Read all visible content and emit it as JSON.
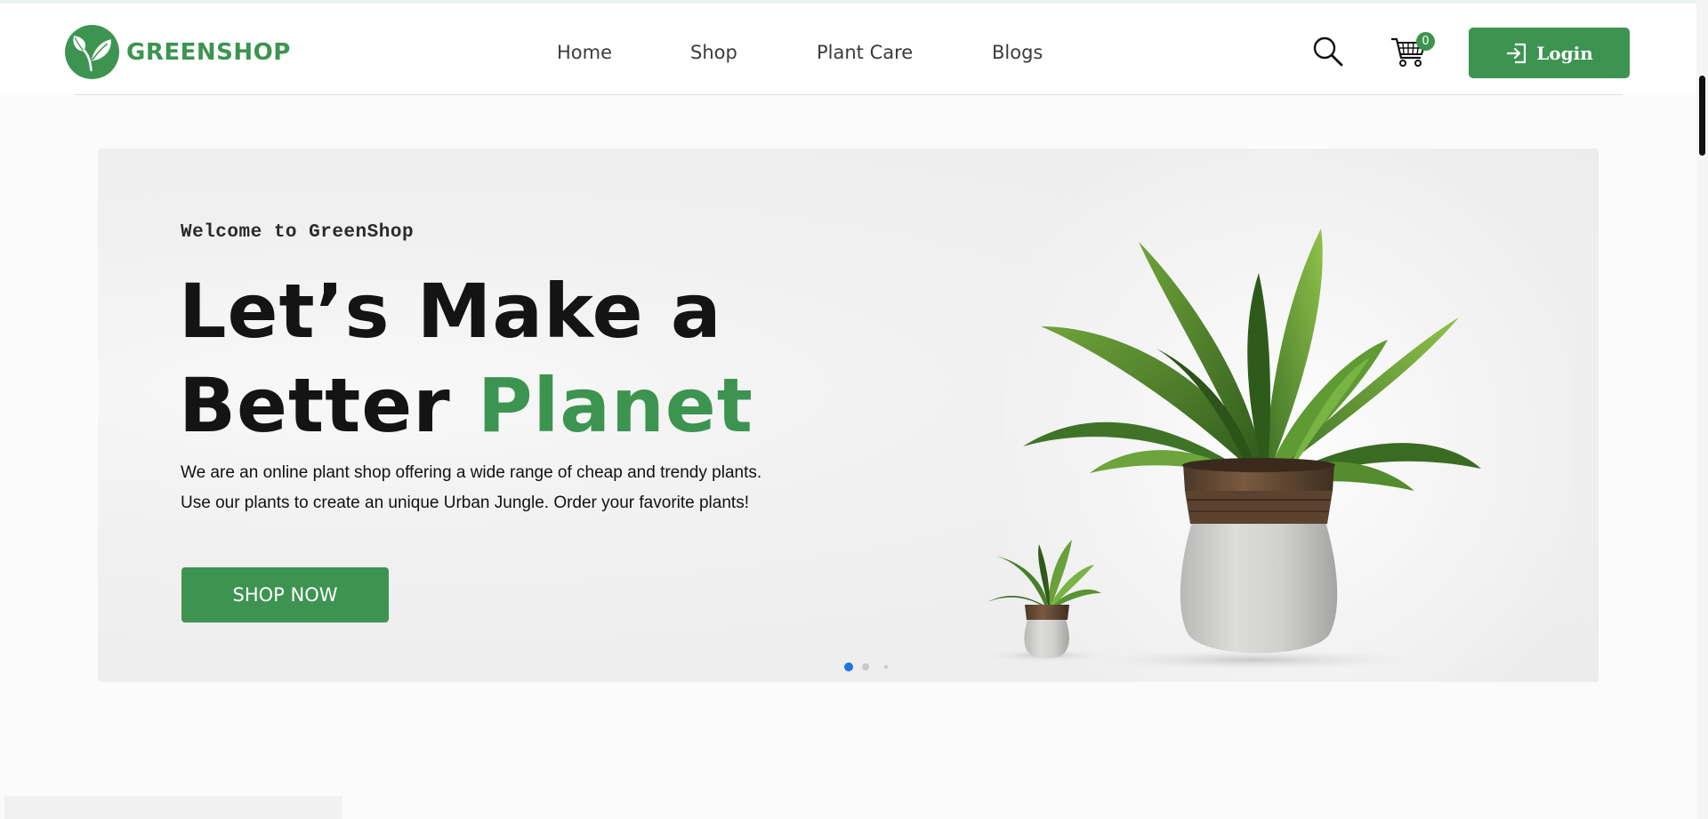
{
  "header": {
    "brand": "GREENSHOP",
    "nav": [
      "Home",
      "Shop",
      "Plant Care",
      "Blogs"
    ],
    "cart_count": "0",
    "login_label": "Login"
  },
  "hero": {
    "welcome": "Welcome to GreenShop",
    "headline_line1": "Let’s Make a",
    "headline_line2_plain": "Better ",
    "headline_line2_accent": "Planet",
    "desc_line1": "We are an online plant shop offering a wide range of cheap and trendy plants.",
    "desc_line2": "Use our plants to create an unique Urban Jungle. Order your favorite plants!",
    "cta_label": "SHOP NOW",
    "slides": {
      "count": 3,
      "active": 1
    }
  },
  "colors": {
    "brand_green": "#3d9450",
    "active_dot": "#1b74e4",
    "text_dark": "#141414"
  },
  "icons": [
    "leaf-logo-icon",
    "search-icon",
    "cart-icon",
    "login-icon"
  ]
}
